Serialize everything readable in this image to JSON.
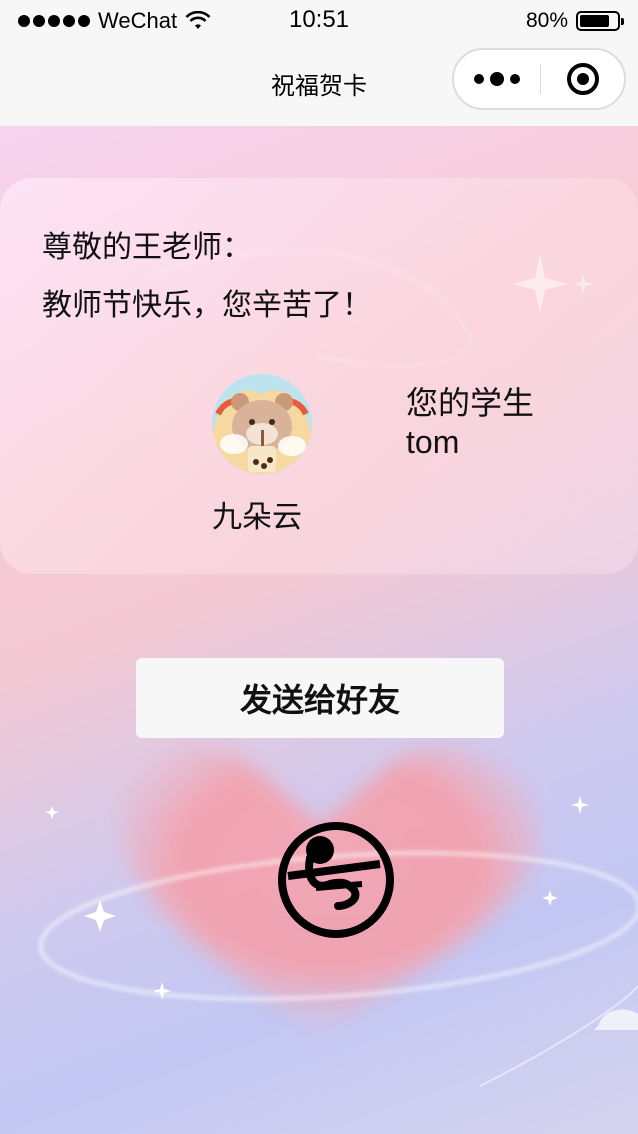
{
  "status_bar": {
    "carrier": "WeChat",
    "time": "10:51",
    "battery": "80%",
    "battery_level": 0.8
  },
  "nav": {
    "title": "祝福贺卡"
  },
  "card": {
    "greeting_line1": "尊敬的王老师：",
    "greeting_line2": "教师节快乐，您辛苦了！",
    "avatar_name": "九朵云",
    "signature_label": "您的学生",
    "signature_name": "tom"
  },
  "actions": {
    "send_label": "发送给好友"
  },
  "icons": {
    "signal": "signal-dots-icon",
    "wifi": "wifi-icon",
    "battery": "battery-icon",
    "more": "more-dots-icon",
    "close": "close-miniprogram-icon",
    "music": "music-toggle-icon"
  }
}
